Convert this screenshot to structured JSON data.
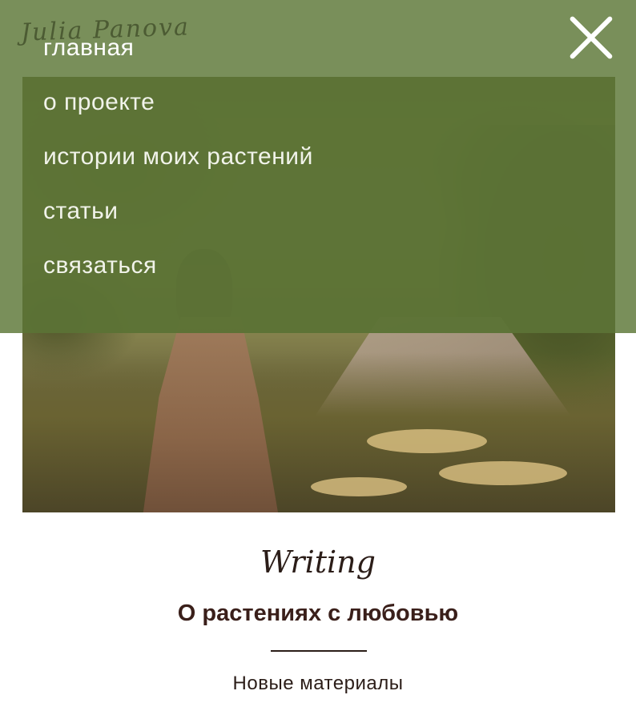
{
  "header": {
    "logo_text": "Julia Panova",
    "close_icon": "close-icon"
  },
  "menu": {
    "items": [
      {
        "label": "главная",
        "active": true
      },
      {
        "label": "о проекте"
      },
      {
        "label": "истории моих растений"
      },
      {
        "label": "статьи"
      },
      {
        "label": "связаться"
      }
    ]
  },
  "hero": {
    "image": "woman-in-trench-coat-walking-on-park-path"
  },
  "section": {
    "kicker": "Writing",
    "title": "О растениях с любовью",
    "subtitle": "Новые материалы"
  },
  "colors": {
    "menu_overlay": "#6e854c",
    "menu_panel": "#4e6424",
    "text_dark": "#2b1d18"
  }
}
